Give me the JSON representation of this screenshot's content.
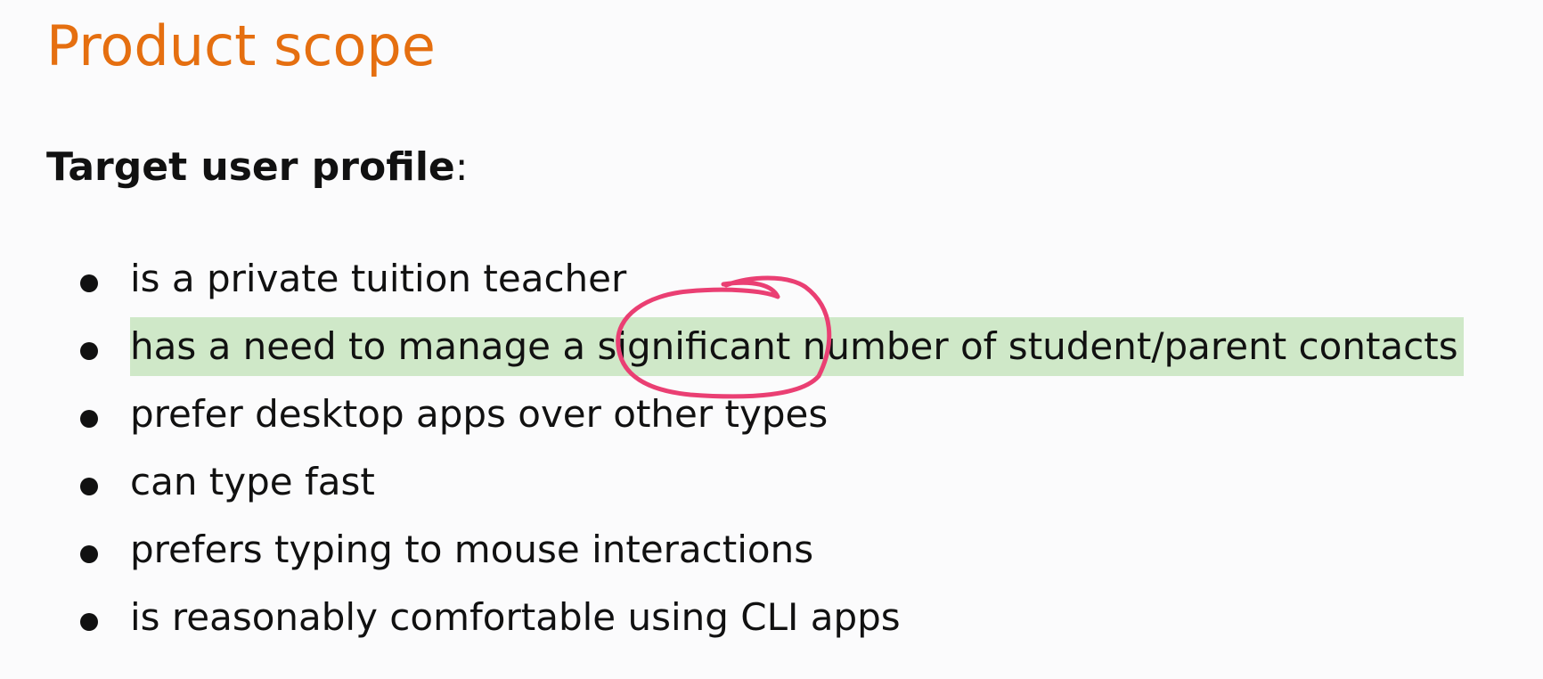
{
  "document": {
    "title": "Product scope",
    "profile_label": "Target user profile",
    "profile_suffix": ":",
    "criteria": [
      "is a private tuition teacher",
      "has a need to manage a",
      "significant",
      "number of student/parent contacts",
      "prefer desktop apps over other types",
      "can type fast",
      "prefers typing to mouse interactions",
      "is reasonably comfortable using CLI apps"
    ]
  },
  "colors": {
    "title": "#e56f10",
    "text": "#111111",
    "highlight": "#cfe8c8",
    "annotation_ink": "#ea3f73",
    "background": "#fbfbfc"
  },
  "icons": {
    "bullet": "bullet-dot-icon",
    "annotation": "hand-drawn-circle-icon"
  }
}
